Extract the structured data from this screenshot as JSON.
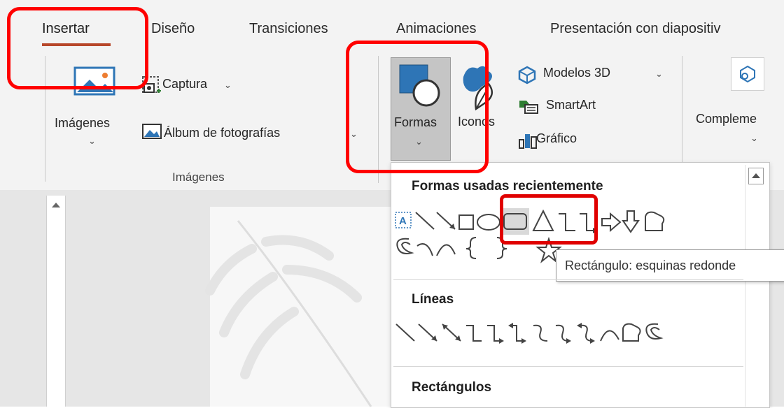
{
  "tabs": [
    "Insertar",
    "Diseño",
    "Transiciones",
    "Animaciones",
    "Presentación con diapositiv"
  ],
  "ribbon": {
    "imagenes_button": "Imágenes",
    "captura": "Captura",
    "album": "Álbum de fotografías",
    "images_group_label": "Imágenes",
    "formas": "Formas",
    "iconos": "Iconos",
    "modelos3d": "Modelos 3D",
    "smartart": "SmartArt",
    "grafico": "Gráfico",
    "complementos": "Compleme",
    "caret": "⌄"
  },
  "dropdown": {
    "recent_header": "Formas usadas recientemente",
    "lineas_header": "Líneas",
    "rectangulos_header": "Rectángulos",
    "tooltip": "Rectángulo: esquinas redonde"
  },
  "colors": {
    "accent_underline": "#b7472a",
    "highlight": "#ff0000",
    "icon_blue": "#2e75b6"
  }
}
